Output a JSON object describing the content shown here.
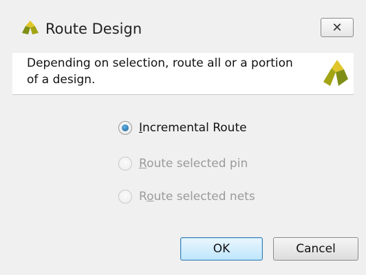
{
  "window": {
    "title": "Route Design",
    "close_glyph": "✕"
  },
  "header": {
    "description": "Depending on selection, route all or a portion of a design."
  },
  "options": [
    {
      "mnemonic": "I",
      "rest": "ncremental Route",
      "checked": true,
      "enabled": true
    },
    {
      "mnemonic": "R",
      "rest": "oute selected pin",
      "checked": false,
      "enabled": false
    },
    {
      "pre": "R",
      "mnemonic": "o",
      "rest": "ute selected nets",
      "checked": false,
      "enabled": false
    }
  ],
  "buttons": {
    "ok": "OK",
    "cancel": "Cancel"
  },
  "colors": {
    "logo_yellow": "#e0c62a",
    "logo_olive": "#a3a514",
    "logo_green": "#7f8f16",
    "accent_radio": "#1c5f96"
  },
  "icons": {
    "title_logo": "vivado-logo-icon",
    "header_logo": "vivado-logo-icon",
    "close": "close-icon"
  }
}
